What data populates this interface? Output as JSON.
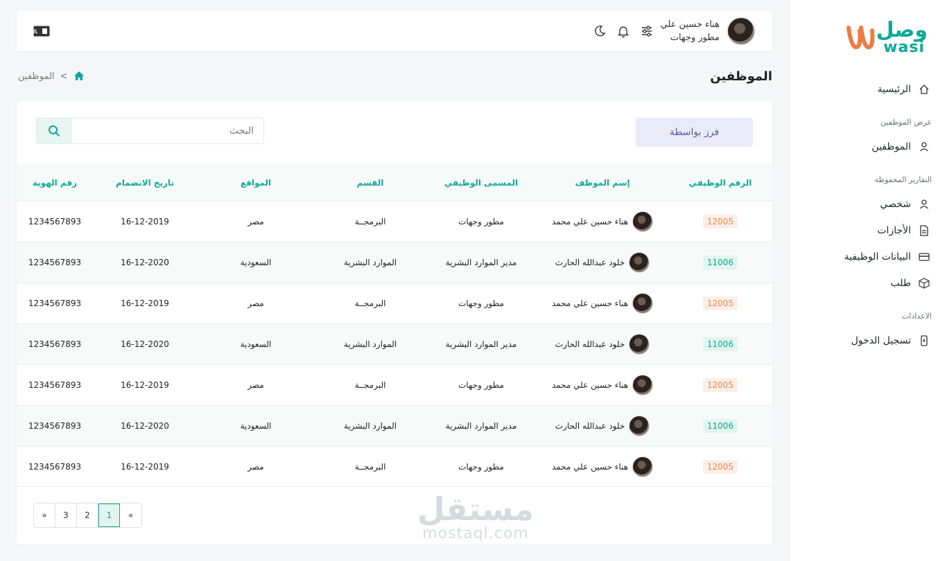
{
  "brand": {
    "name_ar": "وصل",
    "name_en": "wasi"
  },
  "sidebar": {
    "home": "الرئيسية",
    "section_employees": "عرض الموظفين",
    "employees": "الموظفين",
    "section_reports": "التقارير المحفوظة",
    "personal": "شخصي",
    "leaves": "الأجازات",
    "job_data": "البيانات الوظيفية",
    "request": "طلب",
    "section_settings": "الاعدادات",
    "login": "تسجيل الدخول"
  },
  "header": {
    "user_name": "هناء حسين علي",
    "user_role": "مطور وجهات"
  },
  "page": {
    "title": "الموظفين",
    "breadcrumb_current": "الموظفين",
    "breadcrumb_sep": ">"
  },
  "toolbar": {
    "sort_label": "فرز بواسطة",
    "search_placeholder": "البحث"
  },
  "table": {
    "headers": {
      "emp_id": "الرقم الوظيفي",
      "name": "إسم الموظف",
      "title": "المسمى الوظيفي",
      "department": "القسم",
      "location": "المواقع",
      "join_date": "تاريخ الانضمام",
      "id_number": "رقم الهوية"
    },
    "rows": [
      {
        "emp_id": "12005",
        "badge": "orange",
        "name": "هناء حسين علي محمد",
        "title": "مطور وجهات",
        "department": "البرمجــة",
        "location": "مصر",
        "join_date": "16-12-2019",
        "id_number": "1234567893"
      },
      {
        "emp_id": "11006",
        "badge": "green",
        "name": "خلود عبدالله الحارث",
        "title": "مدير الموارد البشرية",
        "department": "الموارد البشرية",
        "location": "السعودية",
        "join_date": "16-12-2020",
        "id_number": "1234567893"
      },
      {
        "emp_id": "12005",
        "badge": "orange",
        "name": "هناء حسين علي محمد",
        "title": "مطور وجهات",
        "department": "البرمجــة",
        "location": "مصر",
        "join_date": "16-12-2019",
        "id_number": "1234567893"
      },
      {
        "emp_id": "11006",
        "badge": "green",
        "name": "خلود عبدالله الحارث",
        "title": "مدير الموارد البشرية",
        "department": "الموارد البشرية",
        "location": "السعودية",
        "join_date": "16-12-2020",
        "id_number": "1234567893"
      },
      {
        "emp_id": "12005",
        "badge": "orange",
        "name": "هناء حسين علي محمد",
        "title": "مطور وجهات",
        "department": "البرمجــة",
        "location": "مصر",
        "join_date": "16-12-2019",
        "id_number": "1234567893"
      },
      {
        "emp_id": "11006",
        "badge": "green",
        "name": "خلود عبدالله الحارث",
        "title": "مدير الموارد البشرية",
        "department": "الموارد البشرية",
        "location": "السعودية",
        "join_date": "16-12-2020",
        "id_number": "1234567893"
      },
      {
        "emp_id": "12005",
        "badge": "orange",
        "name": "هناء حسين علي محمد",
        "title": "مطور وجهات",
        "department": "البرمجــة",
        "location": "مصر",
        "join_date": "16-12-2019",
        "id_number": "1234567893"
      }
    ]
  },
  "pagination": {
    "pages": [
      "1",
      "2",
      "3"
    ],
    "prev": "«",
    "next": "»",
    "active": "1"
  },
  "watermark": {
    "ar": "مستقل",
    "en": "mostaql.com"
  },
  "colors": {
    "accent": "#0fa896",
    "orange_badge": "#e88750",
    "sort_bg": "#ebeaf8"
  }
}
